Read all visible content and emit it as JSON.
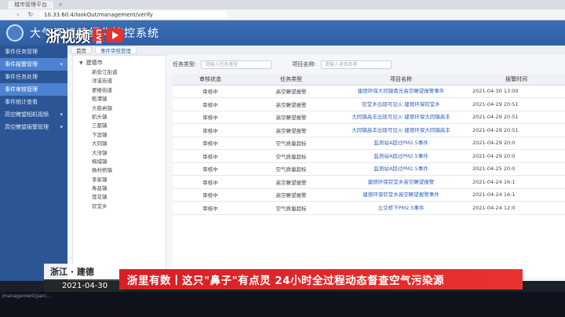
{
  "browser": {
    "tab_title": "城市管理平台",
    "url": "10.33.60.4/lookOut/management/verify"
  },
  "header": {
    "title": "大气环境精细化管控系统"
  },
  "watermark": {
    "brand": "浙视频",
    "tag": "LIVE"
  },
  "sidebar": {
    "items": [
      {
        "label": "事件任务管理"
      },
      {
        "label": "事件报警管理"
      },
      {
        "label": "事件任务处理"
      },
      {
        "label": "事件审核管理"
      },
      {
        "label": "事件统计查看"
      },
      {
        "label": "高空瞭望相机视频"
      },
      {
        "label": "高空瞭望报警管理"
      }
    ]
  },
  "breadcrumb": {
    "items": [
      "首页",
      "事件审核管理"
    ]
  },
  "tree": {
    "root": "建德市",
    "items": [
      "新安江街道",
      "洋溪街道",
      "更楼街道",
      "乾潭镇",
      "大慈岩镇",
      "航头镇",
      "三都镇",
      "下涯镇",
      "大同镇",
      "大洋镇",
      "梅城镇",
      "杨村桥镇",
      "李家镇",
      "寿昌镇",
      "莲花镇",
      "钦堂乡"
    ]
  },
  "filters": {
    "type_label": "任务类型:",
    "type_placeholder": "请输入任务类型",
    "project_label": "项目名称:",
    "project_placeholder": "请输入项目名称"
  },
  "table": {
    "headers": [
      "审核状态",
      "任务类型",
      "项目名称",
      "报警时间"
    ],
    "rows": [
      {
        "status": "审核中",
        "type": "高空瞭望报警",
        "name": "建德环保大同镇南光高空瞭望报警事件",
        "time": "2021-04-30 13:00"
      },
      {
        "status": "审核中",
        "type": "高空瞭望报警",
        "name": "钦堂乡出现可见火  建德环保钦堂乡",
        "time": "2021-04-29 20:51"
      },
      {
        "status": "审核中",
        "type": "高空瞭望报警",
        "name": "大同镇高丰出现可见火  建德环保大同镇高丰",
        "time": "2021-04-29 20:51"
      },
      {
        "status": "审核中",
        "type": "高空瞭望报警",
        "name": "大同镇高丰出现可见火  建德环保大同镇高丰",
        "time": "2021-04-29 20:51"
      },
      {
        "status": "审核中",
        "type": "空气质量超标",
        "name": "监测站4超过PM2.5事件",
        "time": "2021-04-29 20:0"
      },
      {
        "status": "审核中",
        "type": "空气质量超标",
        "name": "监测站4超过PM2.5事件",
        "time": "2021-04-29 20:0"
      },
      {
        "status": "审核中",
        "type": "空气质量超标",
        "name": "监测站4超过PM2.5事件",
        "time": "2021-04-25 20:0"
      },
      {
        "status": "审核中",
        "type": "高空瞭望报警",
        "name": "建德环保钦堂乡高空瞭望报警",
        "time": "2021-04-24 16:1"
      },
      {
        "status": "审核中",
        "type": "高空瞭望报警",
        "name": "建德环保钦堂乡高空瞭望报警事件",
        "time": "2021-04-24 16:1"
      },
      {
        "status": "审核中",
        "type": "空气质量超标",
        "name": "立交桥下PM2.5事件",
        "time": "2021-04-24 12:0"
      }
    ]
  },
  "news": {
    "location": "浙江 · 建德",
    "date": "2021-04-30",
    "headline": "浙里有数丨这只\"鼻子\"有点灵 24小时全过程动态督查空气污染源"
  },
  "status_url": "/management/pani..."
}
